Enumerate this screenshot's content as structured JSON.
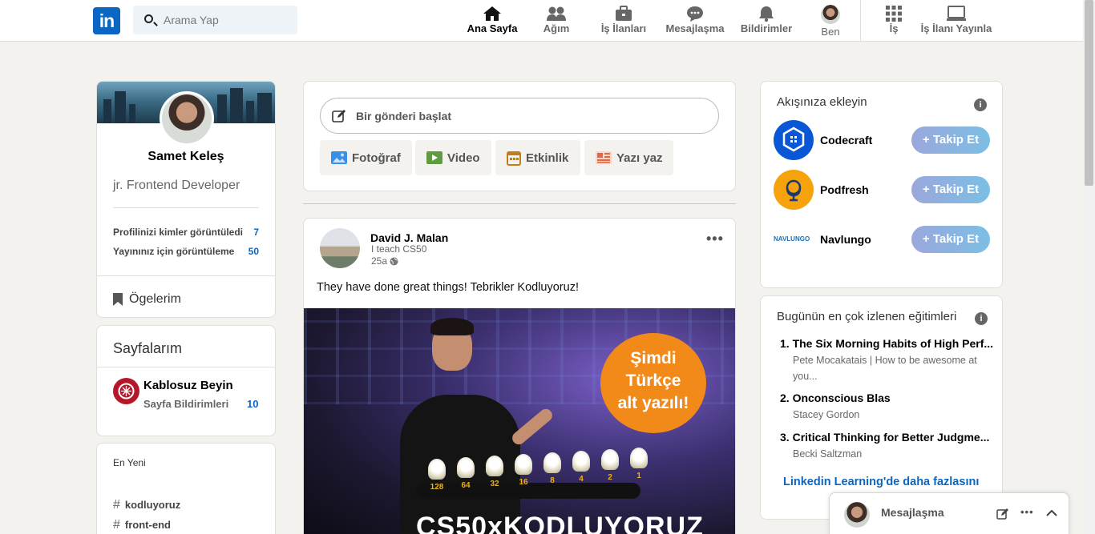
{
  "nav": {
    "logo": "in",
    "search_placeholder": "Arama Yap",
    "items": [
      {
        "label": "Ana Sayfa",
        "icon": "home-icon"
      },
      {
        "label": "Ağım",
        "icon": "network-icon"
      },
      {
        "label": "İş İlanları",
        "icon": "briefcase-icon"
      },
      {
        "label": "Mesajlaşma",
        "icon": "chat-icon"
      },
      {
        "label": "Bildirimler",
        "icon": "bell-icon"
      },
      {
        "label": "Ben",
        "icon": "avatar"
      },
      {
        "label": "İş",
        "icon": "grid-icon"
      },
      {
        "label": "İş İlanı Yayınla",
        "icon": "post-job-icon"
      }
    ]
  },
  "profile": {
    "name": "Samet Keleş",
    "title": "jr. Frontend Developer",
    "stats": [
      {
        "label": "Profilinizi kimler görüntüledi",
        "value": "7"
      },
      {
        "label": "Yayınınız için görüntüleme",
        "value": "50"
      }
    ],
    "items_label": "Ögelerim"
  },
  "pages": {
    "title": "Sayfalarım",
    "page_name": "Kablosuz Beyin",
    "notifications_label": "Sayfa Bildirimleri",
    "notifications_count": "10"
  },
  "recent": {
    "title": "En Yeni",
    "tags": [
      "kodluyoruz",
      "front-end"
    ]
  },
  "composer": {
    "placeholder": "Bir gönderi başlat",
    "actions": [
      {
        "label": "Fotoğraf",
        "icon": "photo-icon",
        "color": "#378fe9"
      },
      {
        "label": "Video",
        "icon": "video-icon",
        "color": "#5f9b41"
      },
      {
        "label": "Etkinlik",
        "icon": "calendar-icon",
        "color": "#c37d16"
      },
      {
        "label": "Yazı yaz",
        "icon": "article-icon",
        "color": "#e16745"
      }
    ]
  },
  "post": {
    "author": "David J. Malan",
    "subtitle": "I teach CS50",
    "time": "25a",
    "text": "They have done great things! Tebrikler Kodluyoruz!",
    "badge_lines": [
      "Şimdi",
      "Türkçe",
      "alt yazılı!"
    ],
    "image_caption": "CS50xKODLUYORUZ",
    "bulb_numbers": [
      "128",
      "64",
      "32",
      "16",
      "8",
      "4",
      "2",
      "1"
    ]
  },
  "follow": {
    "title": "Akışınıza ekleyin",
    "button_label": "+ Takip Et",
    "companies": [
      {
        "name": "Codecraft",
        "logo_text": "CODECRAFT",
        "color": "#0a57d6"
      },
      {
        "name": "Podfresh",
        "color": "#f5a20c"
      },
      {
        "name": "Navlungo",
        "logo_text": "NAVLUNGO",
        "color": "#1a6fb5"
      }
    ]
  },
  "courses": {
    "title": "Bugünün en çok izlenen eğitimleri",
    "items": [
      {
        "rank": "1.",
        "title": "The Six Morning Habits of High Perf...",
        "author": "Pete Mocakatais | How to be awesome at you..."
      },
      {
        "rank": "2.",
        "title": "Onconscious Blas",
        "author": "Stacey Gordon"
      },
      {
        "rank": "3.",
        "title": "Critical Thinking for Better Judgme...",
        "author": "Becki Saltzman"
      }
    ],
    "more_link": "Linkedin Learning'de daha fazlasını"
  },
  "messaging": {
    "label": "Mesajlaşma"
  }
}
